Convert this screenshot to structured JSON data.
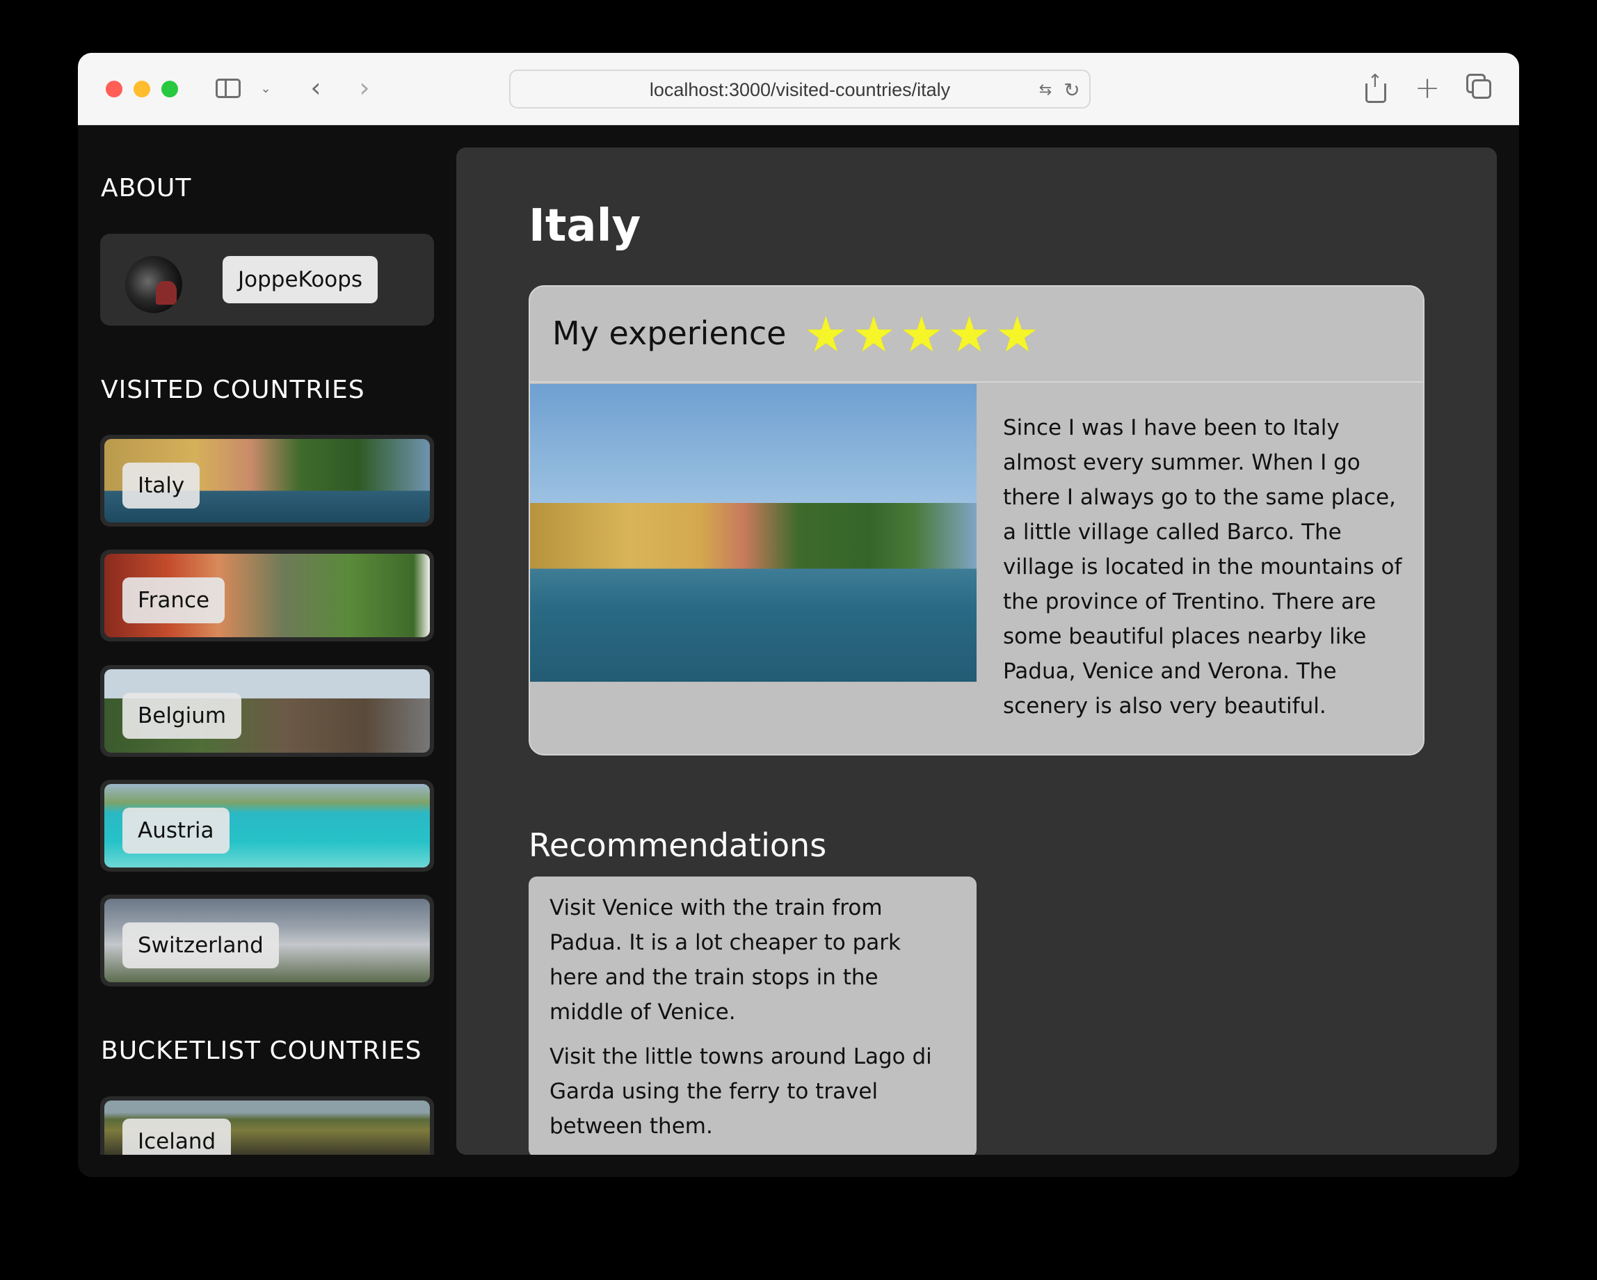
{
  "browser": {
    "url": "localhost:3000/visited-countries/italy"
  },
  "sidebar": {
    "about_heading": "ABOUT",
    "username": "JoppeKoops",
    "visited_heading": "VISITED COUNTRIES",
    "visited": [
      {
        "label": "Italy"
      },
      {
        "label": "France"
      },
      {
        "label": "Belgium"
      },
      {
        "label": "Austria"
      },
      {
        "label": "Switzerland"
      }
    ],
    "bucketlist_heading": "BUCKETLIST COUNTRIES",
    "bucketlist": [
      {
        "label": "Iceland"
      }
    ]
  },
  "main": {
    "title": "Italy",
    "experience": {
      "title": "My experience",
      "rating": 5,
      "text": "Since I was I have been to Italy almost every summer. When I go there I always go to the same place, a little village called Barco. The village is located in the mountains of the province of Trentino. There are some beautiful places nearby like Padua, Venice and Verona. The scenery is also very beautiful."
    },
    "recommendations_heading": "Recommendations",
    "recommendations": [
      "Visit Venice with the train from Padua. It is a lot cheaper to park here and the train stops in the middle of Venice.",
      "Visit the little towns around Lago di Garda using the ferry to travel between them."
    ]
  },
  "colors": {
    "star": "#f5f52a",
    "panel": "#333333",
    "card": "#c0c0c0"
  }
}
